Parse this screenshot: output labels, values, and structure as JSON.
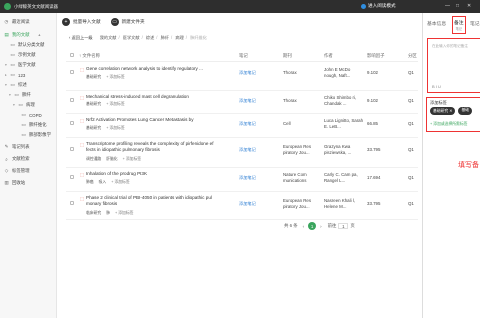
{
  "app": {
    "title": "小绿鲸英文文献阅读器",
    "read_mode": "进入阅读模式",
    "storage": "1050.7M/3.00G",
    "upgrade": "扩容空间",
    "window_controls": [
      "—",
      "□",
      "✕"
    ]
  },
  "sidebar": {
    "items": [
      {
        "label": "最近阅读",
        "icon": "clock-icon"
      },
      {
        "label": "我的文献",
        "icon": "document-icon",
        "active": true
      },
      {
        "label": "默认分类文献",
        "icon": "folder-icon"
      },
      {
        "label": "示例文献",
        "icon": "folder-icon"
      },
      {
        "label": "医学文献",
        "icon": "folder-icon"
      },
      {
        "label": "123",
        "icon": "folder-icon"
      },
      {
        "label": "综述",
        "icon": "folder-icon"
      },
      {
        "label": "肺纤",
        "icon": "folder-icon"
      },
      {
        "label": "病理",
        "icon": "folder-icon"
      },
      {
        "label": "COPD",
        "icon": "folder-icon"
      },
      {
        "label": "肺纤维化",
        "icon": "folder-icon"
      },
      {
        "label": "肺部影像学",
        "icon": "folder-icon"
      },
      {
        "label": "笔记列表",
        "icon": "note-icon"
      },
      {
        "label": "文献检索",
        "icon": "search-icon"
      },
      {
        "label": "标签管理",
        "icon": "tag-icon"
      },
      {
        "label": "回收站",
        "icon": "trash-icon"
      }
    ]
  },
  "toolbar": {
    "import": "批量导入文献",
    "new_folder": "新建文件夹"
  },
  "breadcrumb": {
    "back": "返回上一级",
    "items": [
      "我的文献",
      "医学文献",
      "综述",
      "肺纤",
      "病理"
    ],
    "current": "肺纤维化"
  },
  "table": {
    "headers": [
      "文件名称",
      "笔记",
      "期刊",
      "作者",
      "影响因子",
      "分区"
    ],
    "rows": [
      {
        "title": "Gene correlation network analysis to identify regulatory ...",
        "tags": [
          "基础研究",
          "+ 添加标签"
        ],
        "note": "添加笔记",
        "journal": "Thorax",
        "author": "John E McDo nough, Naft...",
        "if": "9.102",
        "zone": "Q1"
      },
      {
        "title": "Mechanical stress-induced mast cell degranulation",
        "tags": [
          "基础研究",
          "+ 添加标签"
        ],
        "note": "添加笔记",
        "journal": "Thorax",
        "author": "Chiko Shimbo ri, Chandak ...",
        "if": "9.102",
        "zone": "Q1"
      },
      {
        "title": "Nrf2 Activation Promotes Lung Cancer Metastasis by",
        "tags": [
          "基础研究",
          "+ 添加标签"
        ],
        "note": "添加笔记",
        "journal": "Cell",
        "author": "Luca Lignitto, Sarah E. LeB...",
        "if": "66.85",
        "zone": "Q1"
      },
      {
        "title": "Transcriptome profiling reveals the complexity of pirfenidone ef fects in idiopathic pulmonary fibrosis",
        "tags": [
          "调控通路",
          "肝脑化",
          "+ 添加标签"
        ],
        "note": "添加笔记",
        "journal": "European Res piratory Jou...",
        "author": "Grazyna Kwa pisziewska, ...",
        "if": "33.795",
        "zone": "Q1"
      },
      {
        "title": "Inhalation of the prodrug PI3K",
        "tags": [
          "肺癌",
          "吸入",
          "+ 添加标签"
        ],
        "note": "添加笔记",
        "journal": "Nature Com munications",
        "author": "Carly C. Cam pa, Rangel L...",
        "if": "17.694",
        "zone": "Q1"
      },
      {
        "title": "Phase 2 clinical trial of PBI-4050 in patients with idiopathic pul monary fibrosis",
        "tags": [
          "临床研究",
          "肺",
          "+ 添加标签"
        ],
        "note": "添加笔记",
        "journal": "European Res piratory Jou...",
        "author": "Nasreen Khali l, Helene M...",
        "if": "33.795",
        "zone": "Q1"
      }
    ]
  },
  "pager": {
    "total": "共 6 条",
    "prev": "‹",
    "page": "1",
    "next": "›",
    "goto": "前往",
    "page_input": "1",
    "page_suffix": "页"
  },
  "right_panel": {
    "tabs": [
      {
        "label": "基本信息"
      },
      {
        "label": "备注",
        "sub": "笔记",
        "active": true
      },
      {
        "label": "笔记"
      }
    ],
    "note_placeholder": "在此输入你的笔记备注",
    "note_icons": "B I U",
    "tags_label": "添加标签",
    "tags": [
      "基础研究 ✕",
      "基础"
    ],
    "add_tag": "+ 添加或选择所需标签"
  },
  "annotation": "填写备"
}
